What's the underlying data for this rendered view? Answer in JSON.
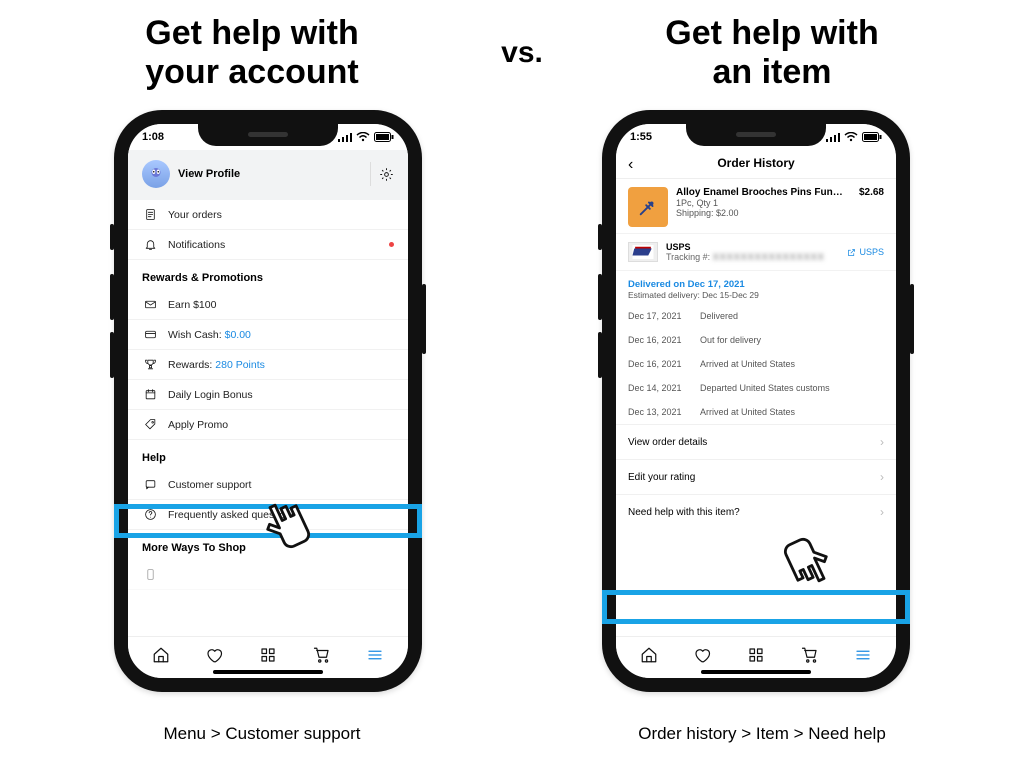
{
  "headings": {
    "left_line1": "Get help with",
    "left_line2": "your account",
    "vs": "vs.",
    "right_line1": "Get help with",
    "right_line2": "an item"
  },
  "captions": {
    "left": "Menu > Customer support",
    "right": "Order history > Item > Need help"
  },
  "colors": {
    "accent": "#19a3e6",
    "link": "#1a8ae2"
  },
  "left": {
    "status_time": "1:08",
    "profile": "View Profile",
    "sections": {
      "account": [
        {
          "icon": "receipt",
          "label": "Your orders"
        },
        {
          "icon": "bell",
          "label": "Notifications",
          "dot": true
        }
      ],
      "rewards_title": "Rewards & Promotions",
      "rewards": [
        {
          "icon": "mail",
          "label": "Earn $100"
        },
        {
          "icon": "card",
          "label": "Wish Cash:",
          "value": "$0.00"
        },
        {
          "icon": "trophy",
          "label": "Rewards:",
          "value": "280 Points"
        },
        {
          "icon": "calendar",
          "label": "Daily Login Bonus"
        },
        {
          "icon": "tag",
          "label": "Apply Promo"
        }
      ],
      "help_title": "Help",
      "help": [
        {
          "icon": "chat",
          "label": "Customer support"
        },
        {
          "icon": "question",
          "label": "Frequently asked questions"
        }
      ],
      "more_title": "More Ways To Shop"
    }
  },
  "right": {
    "status_time": "1:55",
    "page_title": "Order History",
    "product": {
      "title": "Alloy Enamel Brooches Pins Fun…",
      "qty": "1Pc, Qty 1",
      "shipping": "Shipping: $2.00",
      "price": "$2.68"
    },
    "carrier": {
      "name": "USPS",
      "tracking_prefix": "Tracking #:",
      "tracking_value": "(redacted)",
      "link": "USPS"
    },
    "delivered_title": "Delivered on Dec 17, 2021",
    "est": "Estimated delivery: Dec 15-Dec 29",
    "timeline": [
      {
        "date": "Dec 17, 2021",
        "event": "Delivered"
      },
      {
        "date": "Dec 16, 2021",
        "event": "Out for delivery"
      },
      {
        "date": "Dec 16, 2021",
        "event": "Arrived at United States"
      },
      {
        "date": "Dec 14, 2021",
        "event": "Departed United States customs"
      },
      {
        "date": "Dec 13, 2021",
        "event": "Arrived at United States"
      }
    ],
    "actions": [
      "View order details",
      "Edit your rating",
      "Need help with this item?"
    ]
  }
}
